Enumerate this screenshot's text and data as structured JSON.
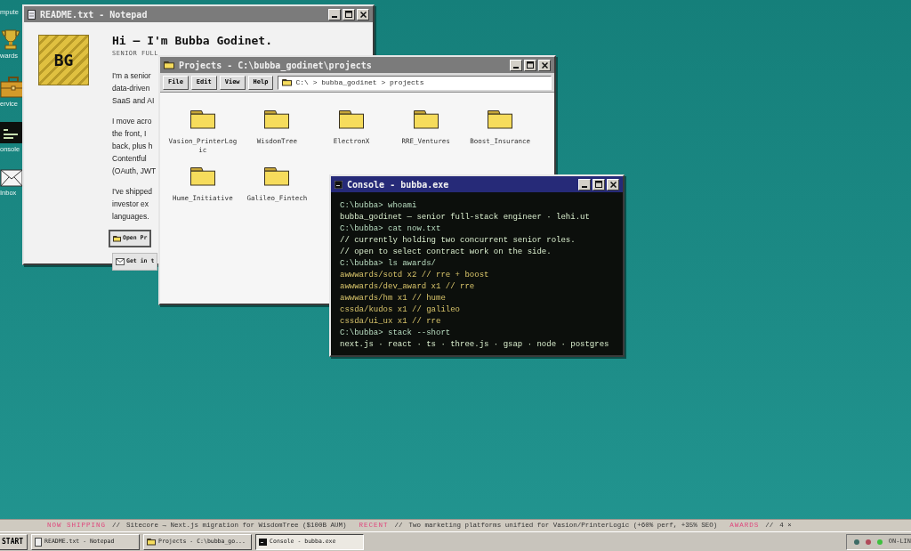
{
  "desktop_icons": [
    {
      "label": "mpute",
      "kind": "computer"
    },
    {
      "label": "wards",
      "kind": "trophy"
    },
    {
      "label": "ervice",
      "kind": "briefcase"
    },
    {
      "label": "onsole",
      "kind": "console"
    },
    {
      "label": "Inbox",
      "kind": "mail"
    }
  ],
  "notepad": {
    "title": "README.txt - Notepad",
    "avatar": "BG",
    "heading": "Hi – I'm Bubba Godinet.",
    "subtitle": "SENIOR FULL",
    "paragraphs": [
      [
        "I'm a senior",
        "data-driven",
        "SaaS and AI"
      ],
      [
        "I move acro",
        "the front, I",
        "back, plus h",
        "Contentful",
        "(OAuth, JWT"
      ],
      [
        "I've shipped",
        "investor ex",
        "languages."
      ]
    ],
    "buttons": [
      {
        "label": "Open Pr",
        "kind": "folder"
      },
      {
        "label": "Get in t",
        "kind": "mail"
      }
    ]
  },
  "projects": {
    "title": "Projects - C:\\bubba_godinet\\projects",
    "menu": [
      "File",
      "Edit",
      "View",
      "Help"
    ],
    "path": "C:\\ > bubba_godinet > projects",
    "folders": [
      "Vasion_PrinterLogic",
      "WisdomTree",
      "ElectronX",
      "RRE_Ventures",
      "Boost_Insurance",
      "Hume_Initiative",
      "Galileo_Fintech"
    ]
  },
  "console": {
    "title": "Console - bubba.exe",
    "lines": [
      {
        "kind": "command",
        "text": "C:\\bubba> whoami"
      },
      {
        "kind": "output",
        "text": "bubba_godinet — senior full-stack engineer · lehi.ut"
      },
      {
        "kind": "command",
        "text": "C:\\bubba> cat now.txt"
      },
      {
        "kind": "output",
        "text": "// currently holding two concurrent senior roles."
      },
      {
        "kind": "output",
        "text": "// open to select contract work on the side."
      },
      {
        "kind": "command",
        "text": "C:\\bubba> ls awards/"
      },
      {
        "kind": "highlight",
        "text": "awwwards/sotd x2 // rre + boost"
      },
      {
        "kind": "highlight",
        "text": "awwwards/dev_award x1 // rre"
      },
      {
        "kind": "highlight",
        "text": "awwwards/hm x1 // hume"
      },
      {
        "kind": "highlight",
        "text": "cssda/kudos x1 // galileo"
      },
      {
        "kind": "highlight",
        "text": "cssda/ui_ux x1 // rre"
      },
      {
        "kind": "command",
        "text": "C:\\bubba> stack --short"
      },
      {
        "kind": "output",
        "text": "next.js · react · ts · three.js · gsap · node · postgres"
      }
    ]
  },
  "ticker": [
    {
      "label": "NOW SHIPPING",
      "sep": "//",
      "text": "Sitecore → Next.js migration for WisdomTree ($100B AUM)"
    },
    {
      "label": "RECENT",
      "sep": "//",
      "text": "Two marketing platforms unified for Vasion/PrinterLogic (+60% perf, +35% SEO)"
    },
    {
      "label": "AWARDS",
      "sep": "//",
      "text": "4 ×"
    }
  ],
  "taskbar": {
    "start": "START",
    "tasks": [
      {
        "label": "README.txt - Notepad",
        "kind": "doc",
        "selected": false
      },
      {
        "label": "Projects - C:\\bubba_go...",
        "kind": "folder",
        "selected": false
      },
      {
        "label": "Console - bubba.exe",
        "kind": "console",
        "selected": true
      }
    ],
    "tray": [
      {
        "color": "#3d6b66"
      },
      {
        "color": "#b04a5a"
      },
      {
        "color": "#3fbf3f"
      }
    ],
    "status": "ON-LIN"
  }
}
